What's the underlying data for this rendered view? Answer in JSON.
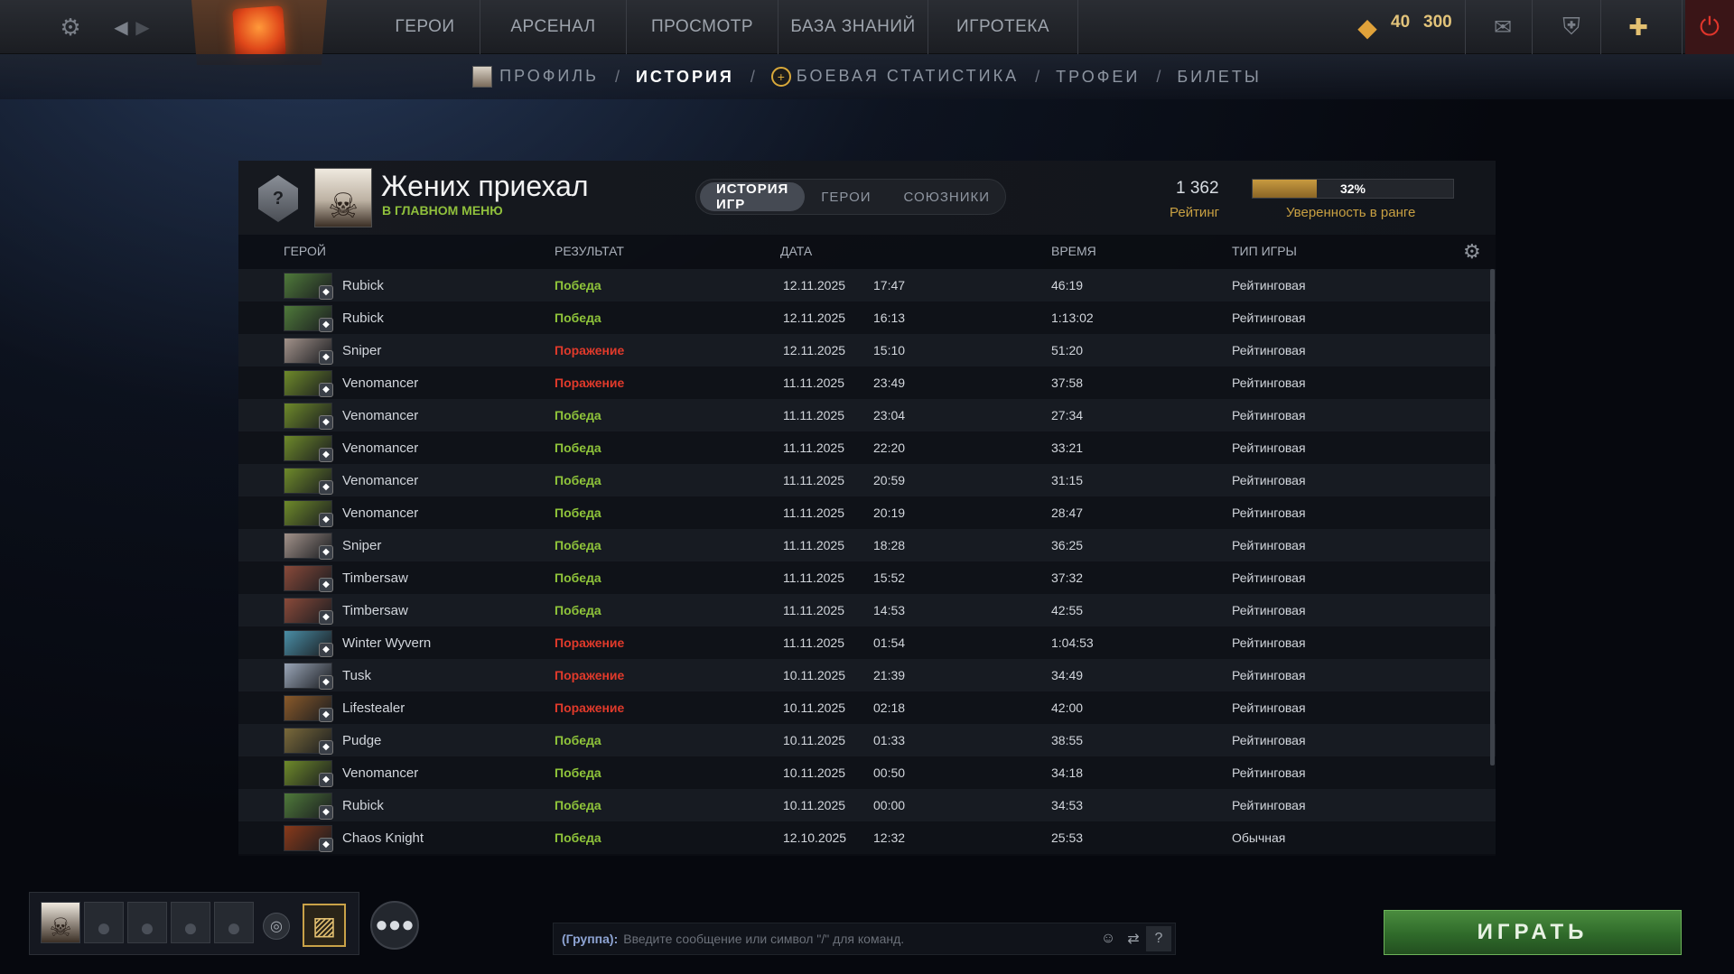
{
  "topbar": {
    "nav": [
      "ГЕРОИ",
      "АРСЕНАЛ",
      "ПРОСМОТР",
      "БАЗА ЗНАНИЙ",
      "ИГРОТЕКА"
    ],
    "shards": "40",
    "gold": "300"
  },
  "subnav": {
    "profile": "ПРОФИЛЬ",
    "history": "ИСТОРИЯ",
    "battle_stats": "БОЕВАЯ СТАТИСТИКА",
    "trophies": "ТРОФЕИ",
    "tickets": "БИЛЕТЫ",
    "slash": "/"
  },
  "profile": {
    "name": "Жених приехал",
    "status": "В ГЛАВНОМ МЕНЮ",
    "rank_mark": "?",
    "tabs": [
      "ИСТОРИЯ ИГР",
      "ГЕРОИ",
      "СОЮЗНИКИ"
    ],
    "rating": "1 362",
    "rating_label": "Рейтинг",
    "confidence": "32%",
    "confidence_value": 0.32,
    "confidence_label": "Уверенность в ранге"
  },
  "table": {
    "headers": {
      "hero": "ГЕРОЙ",
      "result": "РЕЗУЛЬТАТ",
      "date": "ДАТА",
      "time": "ВРЕМЯ",
      "type": "ТИП ИГРЫ"
    },
    "rows": [
      {
        "hero": "Rubick",
        "result": "Победа",
        "win": true,
        "date": "12.11.2025",
        "clock": "17:47",
        "duration": "46:19",
        "type": "Рейтинговая",
        "color": "#4f7a3a"
      },
      {
        "hero": "Rubick",
        "result": "Победа",
        "win": true,
        "date": "12.11.2025",
        "clock": "16:13",
        "duration": "1:13:02",
        "type": "Рейтинговая",
        "color": "#4f7a3a"
      },
      {
        "hero": "Sniper",
        "result": "Поражение",
        "win": false,
        "date": "12.11.2025",
        "clock": "15:10",
        "duration": "51:20",
        "type": "Рейтинговая",
        "color": "#a2928a"
      },
      {
        "hero": "Venomancer",
        "result": "Поражение",
        "win": false,
        "date": "11.11.2025",
        "clock": "23:49",
        "duration": "37:58",
        "type": "Рейтинговая",
        "color": "#6e8a2a"
      },
      {
        "hero": "Venomancer",
        "result": "Победа",
        "win": true,
        "date": "11.11.2025",
        "clock": "23:04",
        "duration": "27:34",
        "type": "Рейтинговая",
        "color": "#6e8a2a"
      },
      {
        "hero": "Venomancer",
        "result": "Победа",
        "win": true,
        "date": "11.11.2025",
        "clock": "22:20",
        "duration": "33:21",
        "type": "Рейтинговая",
        "color": "#6e8a2a"
      },
      {
        "hero": "Venomancer",
        "result": "Победа",
        "win": true,
        "date": "11.11.2025",
        "clock": "20:59",
        "duration": "31:15",
        "type": "Рейтинговая",
        "color": "#6e8a2a"
      },
      {
        "hero": "Venomancer",
        "result": "Победа",
        "win": true,
        "date": "11.11.2025",
        "clock": "20:19",
        "duration": "28:47",
        "type": "Рейтинговая",
        "color": "#6e8a2a"
      },
      {
        "hero": "Sniper",
        "result": "Победа",
        "win": true,
        "date": "11.11.2025",
        "clock": "18:28",
        "duration": "36:25",
        "type": "Рейтинговая",
        "color": "#a2928a"
      },
      {
        "hero": "Timbersaw",
        "result": "Победа",
        "win": true,
        "date": "11.11.2025",
        "clock": "15:52",
        "duration": "37:32",
        "type": "Рейтинговая",
        "color": "#8a4a3a"
      },
      {
        "hero": "Timbersaw",
        "result": "Победа",
        "win": true,
        "date": "11.11.2025",
        "clock": "14:53",
        "duration": "42:55",
        "type": "Рейтинговая",
        "color": "#8a4a3a"
      },
      {
        "hero": "Winter Wyvern",
        "result": "Поражение",
        "win": false,
        "date": "11.11.2025",
        "clock": "01:54",
        "duration": "1:04:53",
        "type": "Рейтинговая",
        "color": "#4a8ea6"
      },
      {
        "hero": "Tusk",
        "result": "Поражение",
        "win": false,
        "date": "10.11.2025",
        "clock": "21:39",
        "duration": "34:49",
        "type": "Рейтинговая",
        "color": "#9aa6b8"
      },
      {
        "hero": "Lifestealer",
        "result": "Поражение",
        "win": false,
        "date": "10.11.2025",
        "clock": "02:18",
        "duration": "42:00",
        "type": "Рейтинговая",
        "color": "#8a5a2a"
      },
      {
        "hero": "Pudge",
        "result": "Победа",
        "win": true,
        "date": "10.11.2025",
        "clock": "01:33",
        "duration": "38:55",
        "type": "Рейтинговая",
        "color": "#7a6a3a"
      },
      {
        "hero": "Venomancer",
        "result": "Победа",
        "win": true,
        "date": "10.11.2025",
        "clock": "00:50",
        "duration": "34:18",
        "type": "Рейтинговая",
        "color": "#6e8a2a"
      },
      {
        "hero": "Rubick",
        "result": "Победа",
        "win": true,
        "date": "10.11.2025",
        "clock": "00:00",
        "duration": "34:53",
        "type": "Рейтинговая",
        "color": "#4f7a3a"
      },
      {
        "hero": "Chaos Knight",
        "result": "Победа",
        "win": true,
        "date": "12.10.2025",
        "clock": "12:32",
        "duration": "25:53",
        "type": "Обычная",
        "color": "#8a3a1a"
      }
    ]
  },
  "chat": {
    "label": "(Группа):",
    "placeholder": "Введите сообщение или символ \"/\" для команд.",
    "help": "?"
  },
  "play_label": "ИГРАТЬ",
  "colors": {
    "win": "#8fc43a",
    "loss": "#e03a2b",
    "accent": "#c8a042"
  }
}
